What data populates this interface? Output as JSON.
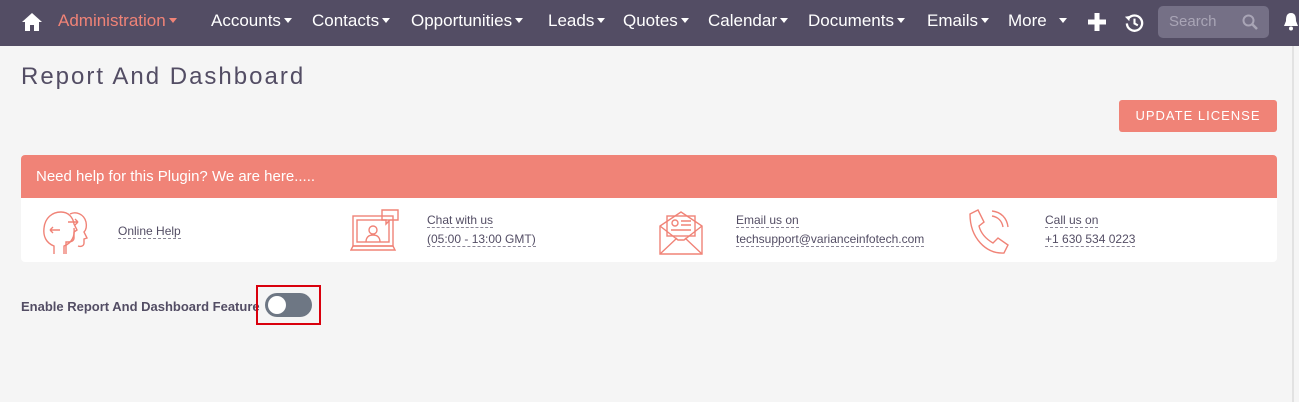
{
  "nav": {
    "home_icon": "home-icon",
    "items": [
      {
        "label": "Administration",
        "active": true
      },
      {
        "label": "Accounts"
      },
      {
        "label": "Contacts"
      },
      {
        "label": "Opportunities"
      },
      {
        "label": "Leads"
      },
      {
        "label": "Quotes"
      },
      {
        "label": "Calendar"
      },
      {
        "label": "Documents"
      },
      {
        "label": "Emails"
      },
      {
        "label": "More"
      }
    ],
    "search_placeholder": "Search",
    "colors": {
      "bar": "#534d64",
      "active": "#f08377",
      "text": "#ffffff"
    }
  },
  "page": {
    "title": "Report And Dashboard",
    "update_button": "UPDATE LICENSE"
  },
  "help": {
    "header": "Need help for this Plugin? We are here.....",
    "online_help": "Online Help",
    "chat_title": "Chat with us",
    "chat_hours": "(05:00 - 13:00 GMT)",
    "email_title": "Email us on",
    "email_address": "techsupport@varianceinfotech.com",
    "call_title": "Call us on",
    "call_number": "+1 630 534 0223"
  },
  "feature": {
    "label": "Enable Report And Dashboard Feature",
    "enabled": false
  },
  "colors": {
    "accent": "#f08377",
    "text": "#534d64",
    "toggle_off": "#6e7784",
    "highlight": "#d9000d"
  }
}
